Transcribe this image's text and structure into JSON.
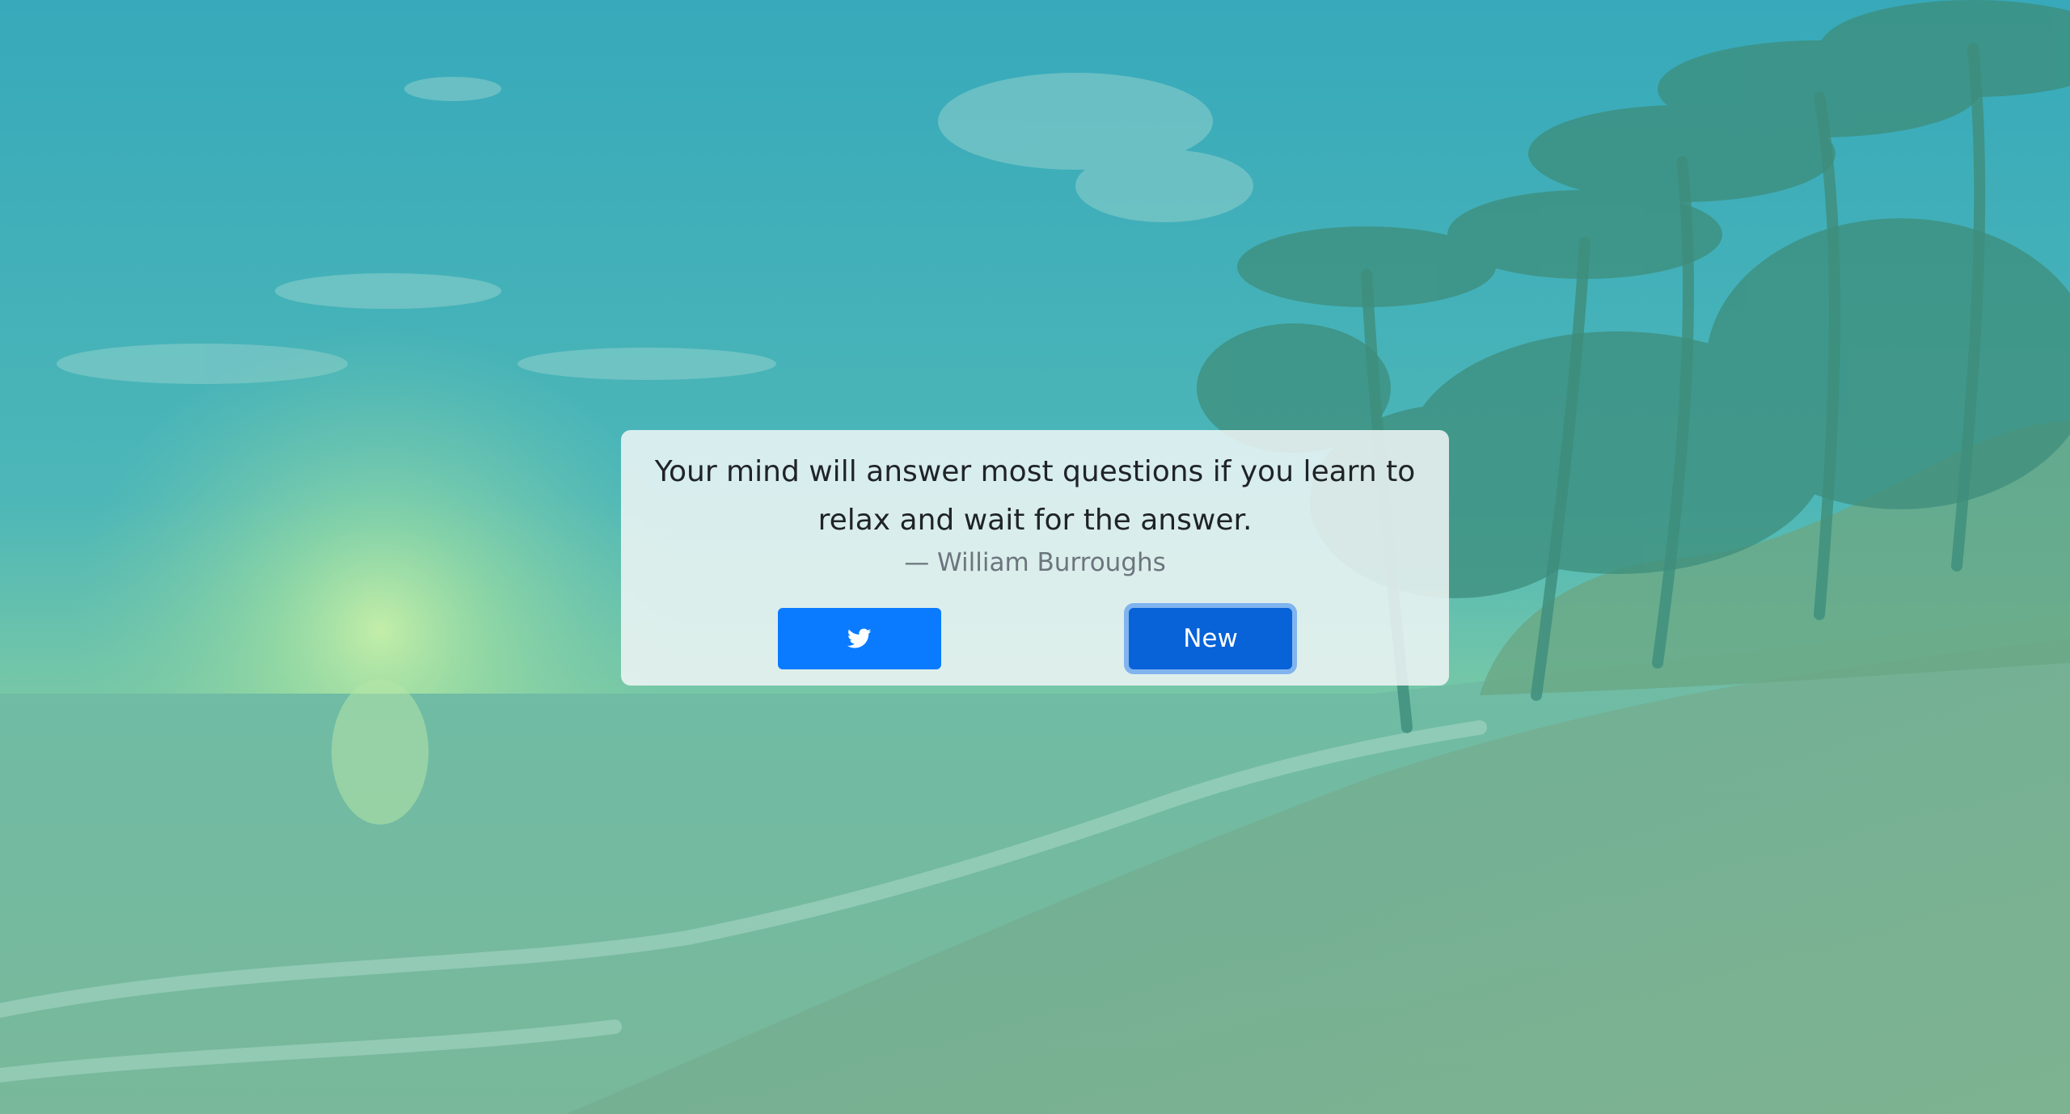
{
  "quote": {
    "text": "Your mind will answer most questions if you learn to relax and wait for the answer.",
    "author": "— William Burroughs"
  },
  "buttons": {
    "tweet_icon": "twitter-icon",
    "new_label": "New"
  },
  "colors": {
    "primary": "#0a7bff",
    "primary_active": "#0862d8",
    "overlay_top": "#37a9b9",
    "overlay_bottom": "#7cbf9a"
  },
  "background": {
    "scene": "beach with palm trees at sunset, tinted teal-green"
  }
}
